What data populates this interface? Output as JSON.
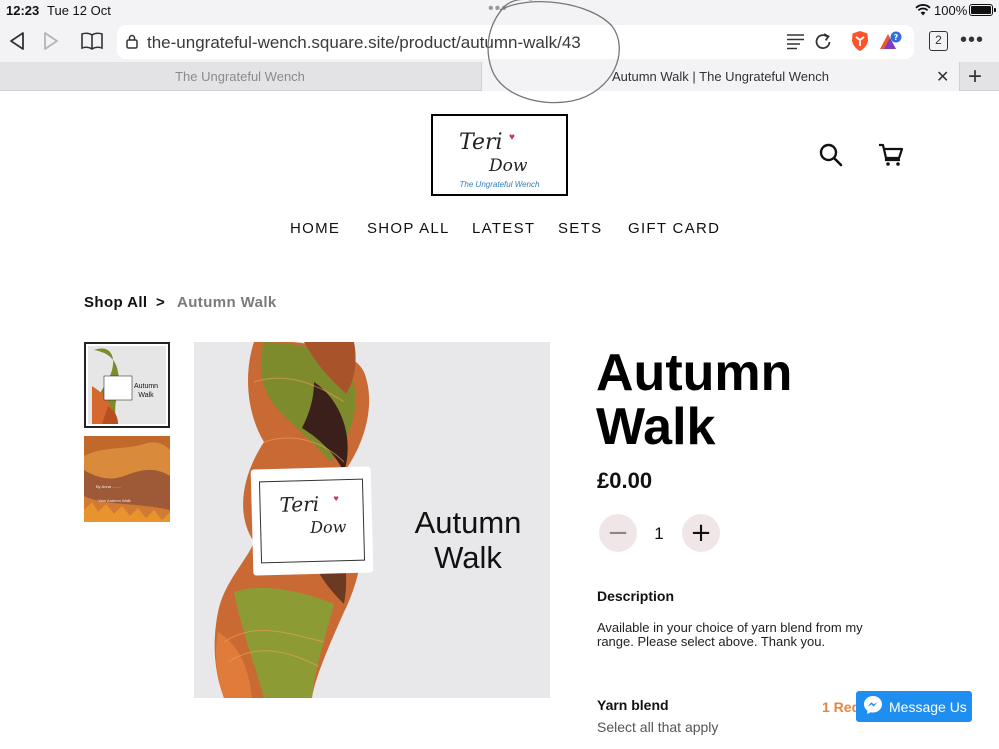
{
  "status_bar": {
    "time": "12:23",
    "date": "Tue 12 Oct",
    "battery_percent": "100%"
  },
  "browser": {
    "url": "the-ungrateful-wench.square.site/product/autumn-walk/43",
    "tab_count": "2",
    "tabs": [
      {
        "title": "The Ungrateful Wench",
        "active": false
      },
      {
        "title": "Autumn Walk | The Ungrateful Wench",
        "active": true
      }
    ],
    "icons": [
      "back-icon",
      "forward-icon",
      "bookmarks-icon",
      "lock-icon",
      "reader-icon",
      "reload-icon",
      "brave-shield-icon",
      "brave-rewards-icon",
      "tabs-icon",
      "more-icon",
      "close-icon",
      "plus-icon"
    ]
  },
  "site": {
    "logo": {
      "line1": "Teri",
      "line2": "Dow",
      "tagline": "The Ungrateful Wench"
    },
    "nav": [
      "HOME",
      "SHOP ALL",
      "LATEST",
      "SETS",
      "GIFT CARD"
    ],
    "breadcrumb": {
      "parent": "Shop All",
      "separator": ">",
      "current": "Autumn Walk"
    }
  },
  "product": {
    "photo_label": "Autumn Walk",
    "label_card": {
      "line1": "Teri",
      "line2": "Dow"
    },
    "title": "Autumn Walk",
    "price": "£0.00",
    "quantity": "1",
    "minus": "−",
    "plus": "+",
    "description_heading": "Description",
    "description": "Available in your choice of yarn blend from my range. Please select above. Thank you.",
    "option_heading": "Yarn blend",
    "option_hint": "Select all that apply",
    "option_required": "1 Req"
  },
  "chat": {
    "label": "Message Us"
  },
  "colors": {
    "accent_orange": "#e7843e",
    "messenger_blue": "#1f8ef1",
    "qty_button_bg": "#f1e6e7"
  }
}
